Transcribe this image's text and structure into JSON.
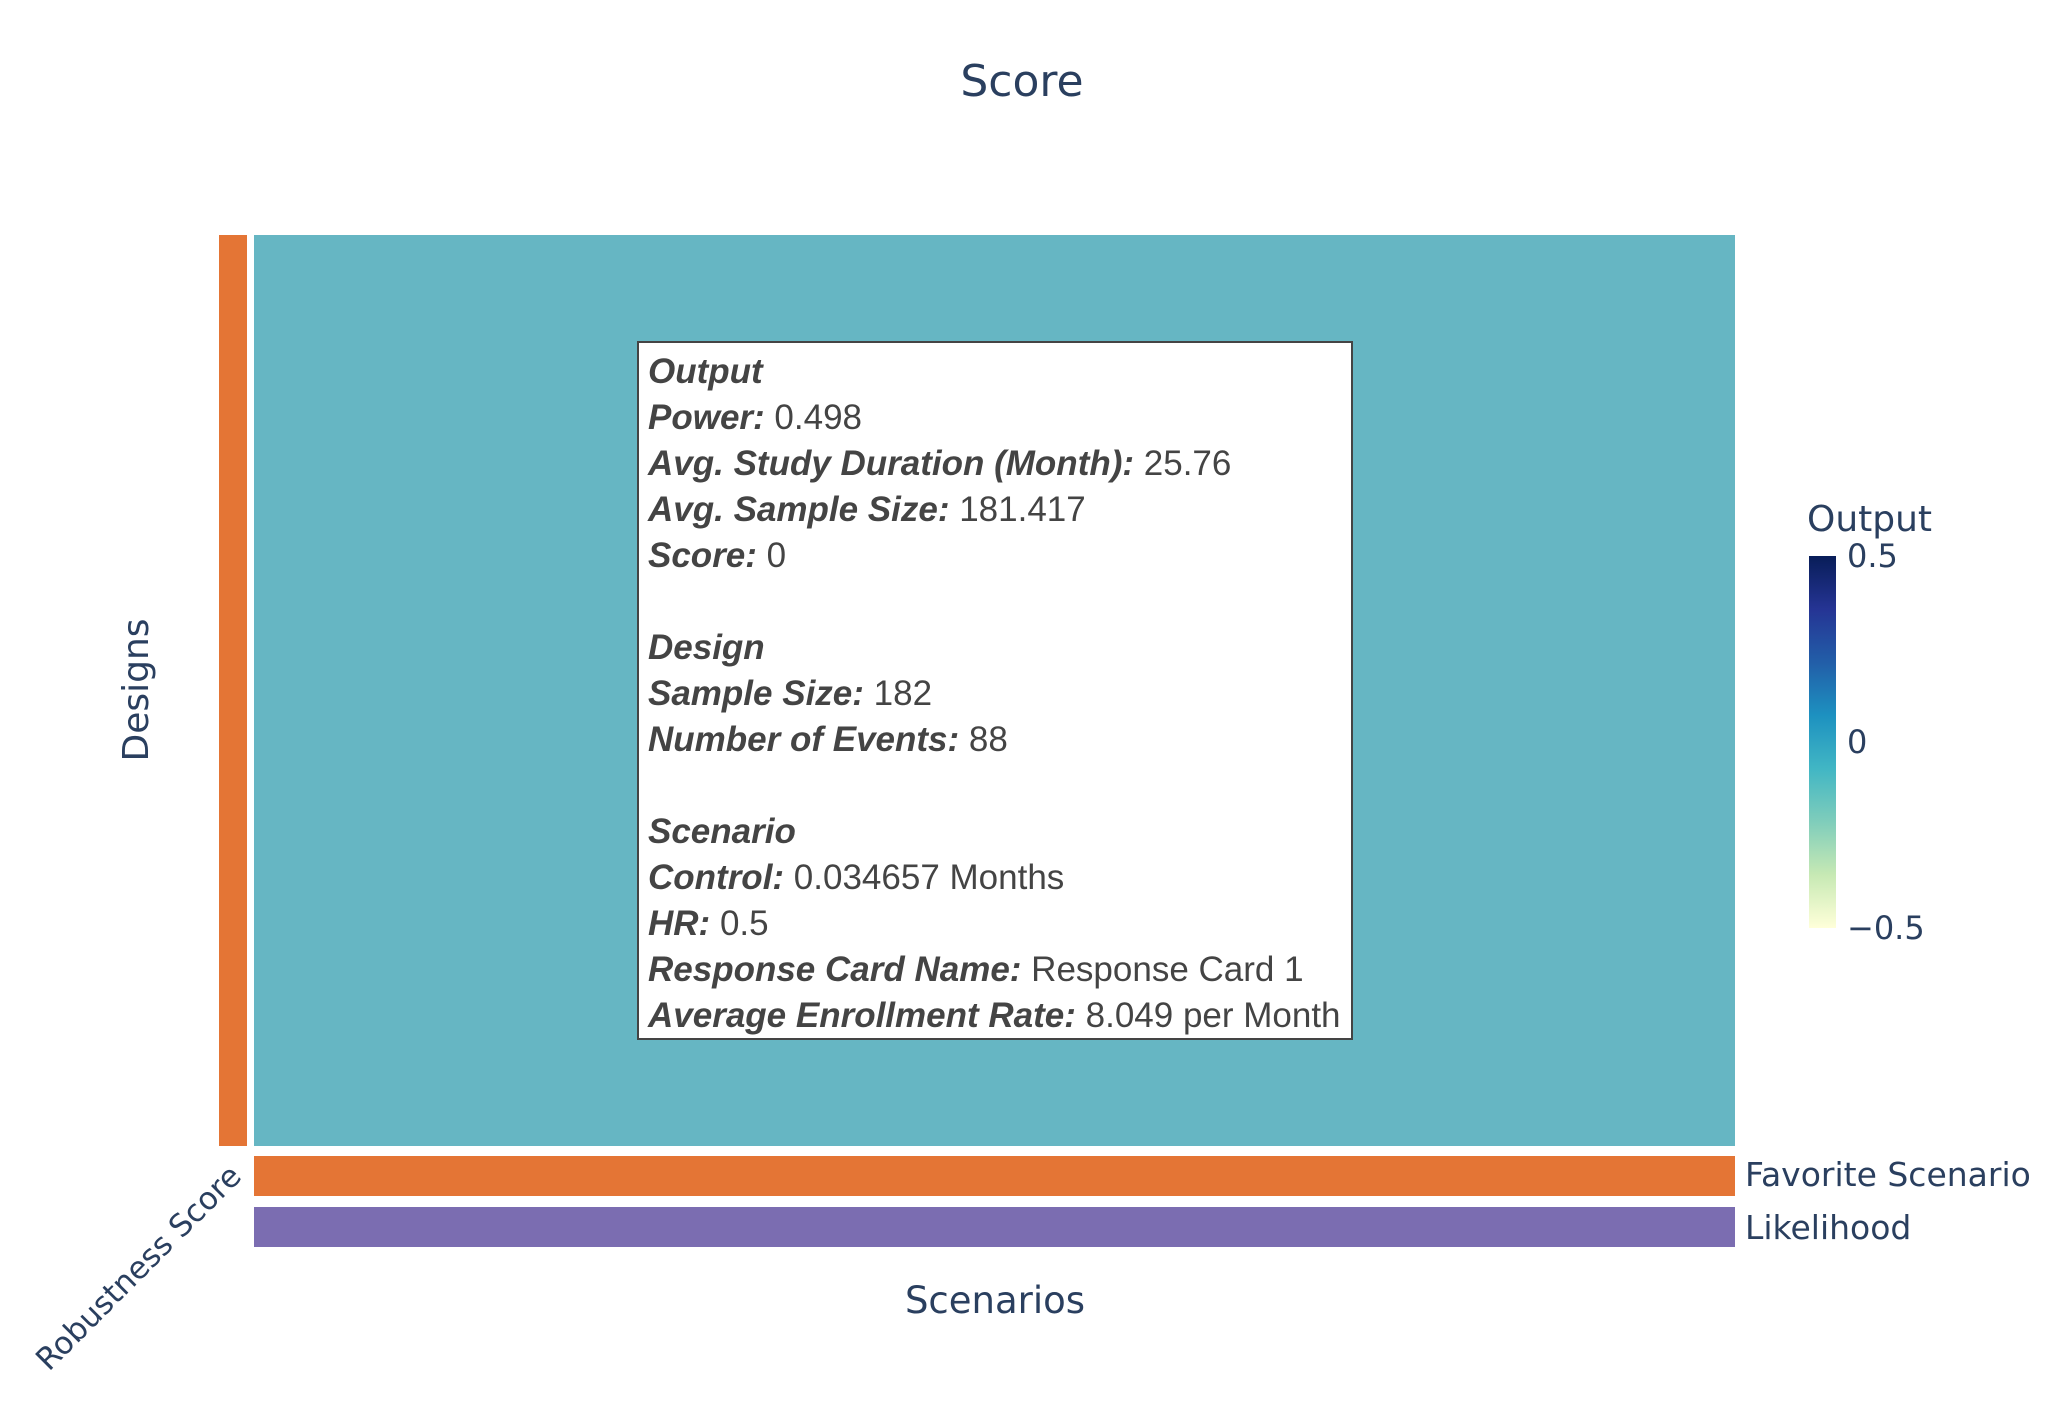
{
  "chart_data": {
    "type": "heatmap",
    "title": "Score",
    "xlabel": "Scenarios",
    "ylabel": "Designs",
    "corner_label": "Robustness Score",
    "z": [
      [
        0
      ]
    ],
    "cell_color": "#66b6c3",
    "row_bars": [
      {
        "label": "Favorite Scenario",
        "color": "#e47535"
      },
      {
        "label": "Likelihood",
        "color": "#7b6db1"
      }
    ],
    "column_bar_color": "#e47535",
    "colorbar": {
      "title": "Output",
      "range": [
        -0.5,
        0.5
      ],
      "ticks": [
        {
          "value": 0.5,
          "label": "0.5"
        },
        {
          "value": 0,
          "label": "0"
        },
        {
          "value": -0.5,
          "label": "−0.5"
        }
      ],
      "colors": [
        "#ffffd9",
        "#c7e9b4",
        "#7fcdbb",
        "#41b6c4",
        "#1d91c0",
        "#225ea8",
        "#253494",
        "#081d58"
      ]
    }
  },
  "tooltip": {
    "groups": [
      {
        "title": "Output",
        "rows": [
          {
            "label": "Power:",
            "value": " 0.498"
          },
          {
            "label": "Avg. Study Duration (Month):",
            "value": " 25.76"
          },
          {
            "label": "Avg. Sample Size:",
            "value": " 181.417"
          },
          {
            "label": "Score:",
            "value": " 0"
          }
        ]
      },
      {
        "title": "Design",
        "rows": [
          {
            "label": "Sample Size:",
            "value": " 182"
          },
          {
            "label": "Number of Events:",
            "value": " 88"
          }
        ]
      },
      {
        "title": "Scenario",
        "rows": [
          {
            "label": "Control:",
            "value": " 0.034657 Months"
          },
          {
            "label": "HR:",
            "value": " 0.5"
          },
          {
            "label": "Response Card Name:",
            "value": " Response Card 1"
          },
          {
            "label": "Average Enrollment Rate:",
            "value": " 8.049 per Month"
          }
        ]
      }
    ]
  }
}
